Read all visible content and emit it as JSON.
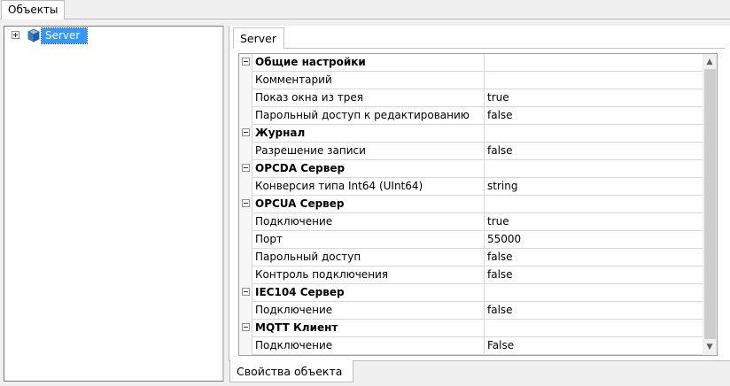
{
  "objects_tab": {
    "label": "Объекты"
  },
  "tree": {
    "root": {
      "label": "Server"
    }
  },
  "server_tab": {
    "label": "Server"
  },
  "bottom_tab": {
    "label": "Свойства объекта"
  },
  "properties": {
    "rows": [
      {
        "category": true,
        "name": "Общие настройки",
        "value": ""
      },
      {
        "category": false,
        "name": "Комментарий",
        "value": ""
      },
      {
        "category": false,
        "name": "Показ окна из трея",
        "value": "true"
      },
      {
        "category": false,
        "name": "Парольный доступ к редактированию",
        "value": "false"
      },
      {
        "category": true,
        "name": "Журнал",
        "value": ""
      },
      {
        "category": false,
        "name": "Разрешение записи",
        "value": "false"
      },
      {
        "category": true,
        "name": "OPCDA Сервер",
        "value": ""
      },
      {
        "category": false,
        "name": "Конверсия типа Int64 (UInt64)",
        "value": "string"
      },
      {
        "category": true,
        "name": "OPCUA Сервер",
        "value": ""
      },
      {
        "category": false,
        "name": "Подключение",
        "value": "true"
      },
      {
        "category": false,
        "name": "Порт",
        "value": "55000"
      },
      {
        "category": false,
        "name": "Парольный доступ",
        "value": "false"
      },
      {
        "category": false,
        "name": "Контроль подключения",
        "value": "false"
      },
      {
        "category": true,
        "name": "IEC104 Сервер",
        "value": ""
      },
      {
        "category": false,
        "name": "Подключение",
        "value": "false"
      },
      {
        "category": true,
        "name": "MQTT Клиент",
        "value": ""
      },
      {
        "category": false,
        "name": "Подключение",
        "value": "False"
      }
    ]
  },
  "icons": {
    "expand": "plus-box-icon",
    "collapse": "minus-box-icon",
    "server": "server-cube-icon",
    "scroll_up": "arrow-up-icon",
    "scroll_down": "arrow-down-icon"
  },
  "colors": {
    "selection": "#3399ff",
    "server_icon": "#3b7fc4"
  }
}
